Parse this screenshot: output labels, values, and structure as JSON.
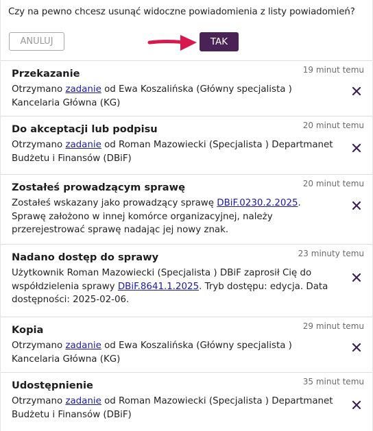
{
  "dialog": {
    "question": "Czy na pewno chcesz usunąć widoczne powiadomienia z listy powiadomień?",
    "cancel_label": "ANULUJ",
    "confirm_label": "TAK"
  },
  "colors": {
    "confirm_button": "#4b2256",
    "arrow": "#d8194e",
    "link": "#1a1aa6",
    "close_icon": "#3b2250"
  },
  "notifications": [
    {
      "title": "Przekazanie",
      "time": "19 minut temu",
      "text_before": "Otrzymano ",
      "link": "zadanie",
      "text_after": " od Ewa Koszalińska (Główny specjalista ) Kancelaria Główna (KG)",
      "close_icon": "x-icon"
    },
    {
      "title": "Do akceptacji lub podpisu",
      "time": "20 minut temu",
      "text_before": "Otrzymano ",
      "link": "zadanie",
      "text_after": " od Roman Mazowiecki (Specjalista ) Departmanet Budżetu i Finansów (DBiF)",
      "close_icon": "x-icon"
    },
    {
      "title": "Zostałeś prowadzącym sprawę",
      "time": "20 minut temu",
      "text_before": "Zostałeś wskazany jako prowadzący sprawę ",
      "link": "DBiF.0230.2.2025",
      "text_after": ". Sprawę założono w innej komórce organizacyjnej, należy przerejestrować sprawę nadając jej nowy znak.",
      "close_icon": "x-icon"
    },
    {
      "title": "Nadano dostęp do sprawy",
      "time": "23 minuty temu",
      "text_before": "Użytkownik Roman Mazowiecki (Specjalista ) DBiF zaprosił Cię do współdzielenia sprawy ",
      "link": "DBiF.8641.1.2025",
      "text_after": ". Tryb dostępu: edycja. Data dostępności: 2025-02-06.",
      "close_icon": "x-icon"
    },
    {
      "title": "Kopia",
      "time": "29 minut temu",
      "text_before": "Otrzymano ",
      "link": "zadanie",
      "text_after": " od Ewa Koszalińska (Główny specjalista ) Kancelaria Główna (KG)",
      "close_icon": "x-icon"
    },
    {
      "title": "Udostępnienie",
      "time": "35 minut temu",
      "text_before": "Otrzymano ",
      "link": "zadanie",
      "text_after": " od Roman Mazowiecki (Specjalista ) Departmanet Budżetu i Finansów (DBiF)",
      "close_icon": "x-icon"
    }
  ]
}
